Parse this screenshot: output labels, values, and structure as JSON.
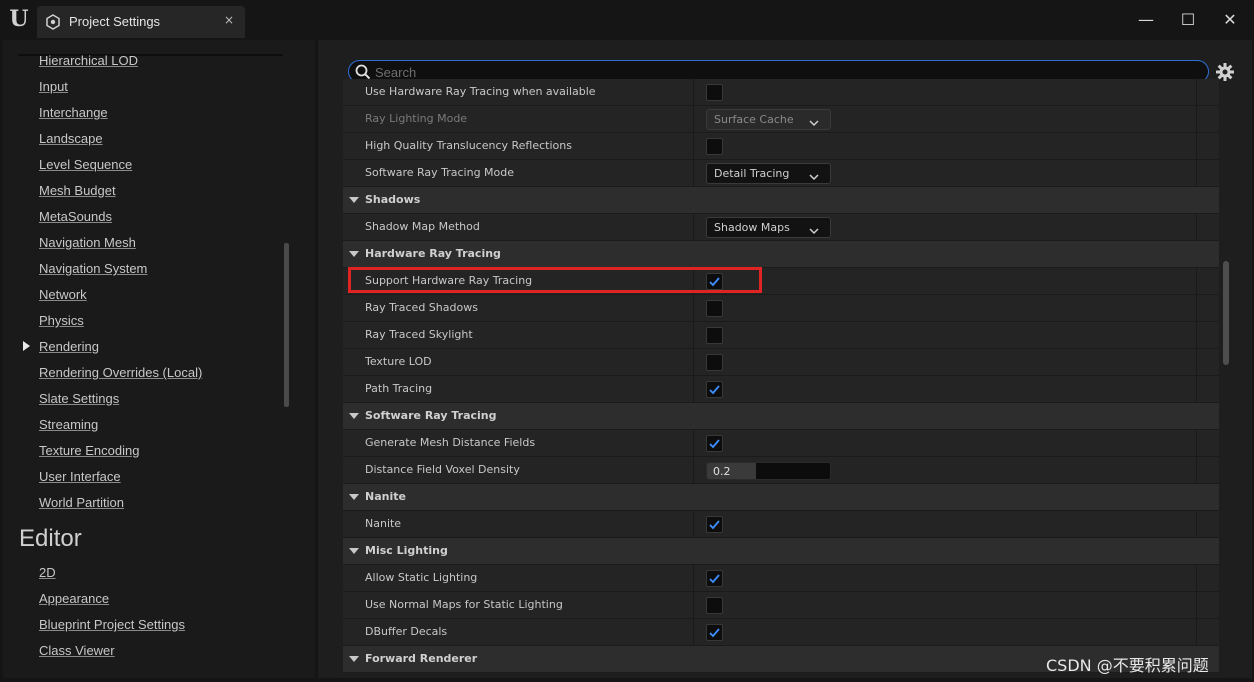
{
  "window": {
    "tab_title": "Project Settings",
    "tab_close": "×",
    "controls": {
      "minimize": "—",
      "maximize": "☐",
      "close": "✕"
    }
  },
  "sidebar": {
    "items": [
      "Hierarchical LOD",
      "Input",
      "Interchange",
      "Landscape",
      "Level Sequence",
      "Mesh Budget",
      "MetaSounds",
      "Navigation Mesh",
      "Navigation System",
      "Network",
      "Physics",
      "Rendering",
      "Rendering Overrides (Local)",
      "Slate Settings",
      "Streaming",
      "Texture Encoding",
      "User Interface",
      "World Partition"
    ],
    "selected": "Rendering",
    "editor_heading": "Editor",
    "editor_items": [
      "2D",
      "Appearance",
      "Blueprint Project Settings",
      "Class Viewer"
    ]
  },
  "search": {
    "placeholder": "Search",
    "value": ""
  },
  "settings": {
    "rows": [
      {
        "type": "setting",
        "label": "Use Hardware Ray Tracing when available",
        "control": "checkbox",
        "checked": false
      },
      {
        "type": "setting",
        "label": "Ray Lighting Mode",
        "control": "dropdown",
        "value": "Surface Cache",
        "disabled": true
      },
      {
        "type": "setting",
        "label": "High Quality Translucency Reflections",
        "control": "checkbox",
        "checked": false
      },
      {
        "type": "setting",
        "label": "Software Ray Tracing Mode",
        "control": "dropdown",
        "value": "Detail Tracing"
      },
      {
        "type": "category",
        "label": "Shadows"
      },
      {
        "type": "setting",
        "label": "Shadow Map Method",
        "control": "dropdown",
        "value": "Shadow Maps"
      },
      {
        "type": "category",
        "label": "Hardware Ray Tracing"
      },
      {
        "type": "setting",
        "label": "Support Hardware Ray Tracing",
        "control": "checkbox",
        "checked": true,
        "highlighted": true
      },
      {
        "type": "setting",
        "label": "Ray Traced Shadows",
        "control": "checkbox",
        "checked": false
      },
      {
        "type": "setting",
        "label": "Ray Traced Skylight",
        "control": "checkbox",
        "checked": false
      },
      {
        "type": "setting",
        "label": "Texture LOD",
        "control": "checkbox",
        "checked": false
      },
      {
        "type": "setting",
        "label": "Path Tracing",
        "control": "checkbox",
        "checked": true
      },
      {
        "type": "category",
        "label": "Software Ray Tracing"
      },
      {
        "type": "setting",
        "label": "Generate Mesh Distance Fields",
        "control": "checkbox",
        "checked": true
      },
      {
        "type": "setting",
        "label": "Distance Field Voxel Density",
        "control": "number",
        "value": "0.2",
        "fill_fraction": 0.4
      },
      {
        "type": "category",
        "label": "Nanite"
      },
      {
        "type": "setting",
        "label": "Nanite",
        "control": "checkbox",
        "checked": true
      },
      {
        "type": "category",
        "label": "Misc Lighting"
      },
      {
        "type": "setting",
        "label": "Allow Static Lighting",
        "control": "checkbox",
        "checked": true
      },
      {
        "type": "setting",
        "label": "Use Normal Maps for Static Lighting",
        "control": "checkbox",
        "checked": false
      },
      {
        "type": "setting",
        "label": "DBuffer Decals",
        "control": "checkbox",
        "checked": true
      },
      {
        "type": "category",
        "label": "Forward Renderer"
      }
    ]
  },
  "watermark": "CSDN @不要积累问题",
  "colors": {
    "accent": "#2f6fd6",
    "check": "#3d8eff",
    "highlight": "#e02424"
  }
}
